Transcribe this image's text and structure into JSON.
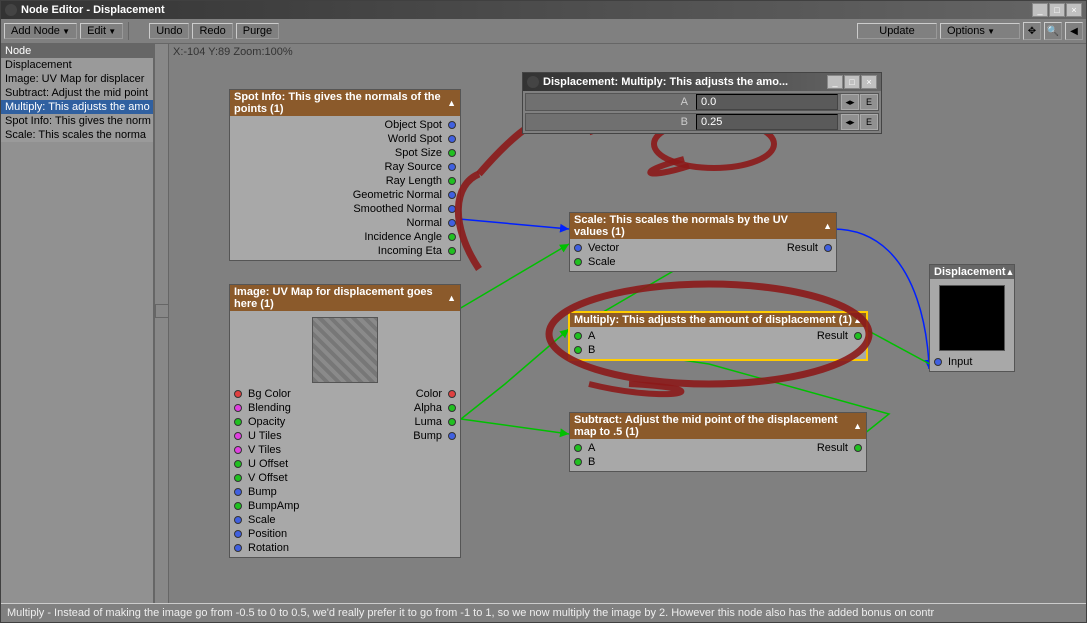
{
  "window": {
    "title": "Node Editor - Displacement"
  },
  "toolbar": {
    "add_node": "Add Node",
    "edit": "Edit",
    "undo": "Undo",
    "redo": "Redo",
    "purge": "Purge",
    "update": "Update",
    "options": "Options"
  },
  "sidebar": {
    "header": "Node",
    "items": [
      "Displacement",
      "Image: UV Map for displacer",
      "Subtract: Adjust the mid point",
      "Multiply: This adjusts the amo",
      "Spot Info: This gives the norm",
      "Scale: This scales the norma"
    ],
    "selected_index": 3
  },
  "canvas": {
    "coords": "X:-104 Y:89 Zoom:100%"
  },
  "status": "Multiply - Instead of making the image go from -0.5 to 0 to 0.5, we'd really prefer it to go from -1 to 1, so we now multiply the image by 2. However this node also has the added bonus on contr",
  "nodes": {
    "spot_info": {
      "title": "Spot Info: This gives the normals of the points (1)",
      "outputs": [
        {
          "label": "Object Spot",
          "color": "blue"
        },
        {
          "label": "World Spot",
          "color": "blue"
        },
        {
          "label": "Spot Size",
          "color": "green"
        },
        {
          "label": "Ray Source",
          "color": "blue"
        },
        {
          "label": "Ray Length",
          "color": "green"
        },
        {
          "label": "Geometric Normal",
          "color": "blue"
        },
        {
          "label": "Smoothed Normal",
          "color": "blue"
        },
        {
          "label": "Normal",
          "color": "blue"
        },
        {
          "label": "Incidence Angle",
          "color": "green"
        },
        {
          "label": "Incoming Eta",
          "color": "green"
        }
      ]
    },
    "image": {
      "title": "Image: UV Map for displacement goes here (1)",
      "inputs": [
        {
          "label": "Bg Color",
          "color": "red"
        },
        {
          "label": "Blending",
          "color": "magenta"
        },
        {
          "label": "Opacity",
          "color": "green"
        },
        {
          "label": "U Tiles",
          "color": "magenta"
        },
        {
          "label": "V Tiles",
          "color": "magenta"
        },
        {
          "label": "U Offset",
          "color": "green"
        },
        {
          "label": "V Offset",
          "color": "green"
        },
        {
          "label": "Bump",
          "color": "blue"
        },
        {
          "label": "BumpAmp",
          "color": "green"
        },
        {
          "label": "Scale",
          "color": "blue"
        },
        {
          "label": "Position",
          "color": "blue"
        },
        {
          "label": "Rotation",
          "color": "blue"
        }
      ],
      "outputs": [
        {
          "label": "Color",
          "color": "red"
        },
        {
          "label": "Alpha",
          "color": "green"
        },
        {
          "label": "Luma",
          "color": "green"
        },
        {
          "label": "Bump",
          "color": "blue"
        }
      ]
    },
    "scale": {
      "title": "Scale: This scales the normals by the UV values  (1)",
      "inputs": [
        {
          "label": "Vector",
          "color": "blue"
        },
        {
          "label": "Scale",
          "color": "green"
        }
      ],
      "result": "Result"
    },
    "multiply": {
      "title": "Multiply: This adjusts the amount of displacement (1)",
      "inputs": [
        {
          "label": "A",
          "color": "green"
        },
        {
          "label": "B",
          "color": "green"
        }
      ],
      "result": "Result"
    },
    "subtract": {
      "title": "Subtract: Adjust the mid point of the displacement map to .5 (1)",
      "inputs": [
        {
          "label": "A",
          "color": "green"
        },
        {
          "label": "B",
          "color": "green"
        }
      ],
      "result": "Result"
    },
    "displacement": {
      "title": "Displacement",
      "input_label": "Input"
    }
  },
  "panel": {
    "title": "Displacement: Multiply: This adjusts the amo...",
    "rows": [
      {
        "label": "A",
        "value": "0.0",
        "btn": "E"
      },
      {
        "label": "B",
        "value": "0.25",
        "btn": "E"
      }
    ]
  }
}
